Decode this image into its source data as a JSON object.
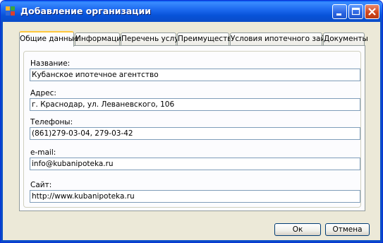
{
  "window": {
    "title": "Добавление организации"
  },
  "tabs": [
    {
      "label": "Общие данные"
    },
    {
      "label": "Информация"
    },
    {
      "label": "Перечень услуг"
    },
    {
      "label": "Преимущества"
    },
    {
      "label": "Условия ипотечного займа"
    },
    {
      "label": "Документы"
    }
  ],
  "form": {
    "name": {
      "label": "Название:",
      "value": "Кубанское ипотечное агентство"
    },
    "address": {
      "label": "Адрес:",
      "value": "г. Краснодар, ул. Леваневского, 106"
    },
    "phones": {
      "label": "Телефоны:",
      "value": "(861)279-03-04, 279-03-42"
    },
    "email": {
      "label": "e-mail:",
      "value": "info@kubanipoteka.ru"
    },
    "site": {
      "label": "Сайт:",
      "value": "http://www.kubanipoteka.ru"
    }
  },
  "buttons": {
    "ok": "Ок",
    "cancel": "Отмена"
  },
  "icons": {
    "app": "app-icon",
    "minimize": "minimize-icon",
    "maximize": "maximize-icon",
    "close": "close-icon"
  },
  "colors": {
    "titlebar": "#0A5EF0",
    "active_tab_highlight": "#FFC83C",
    "window_bg": "#ECE9D8"
  }
}
